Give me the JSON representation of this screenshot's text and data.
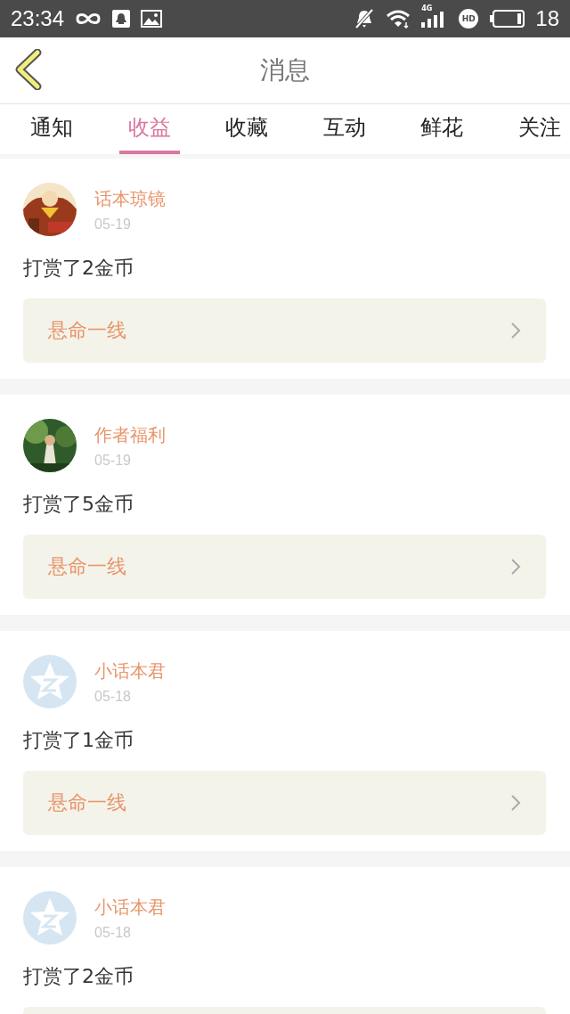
{
  "status_bar": {
    "time": "23:34",
    "network": "4G",
    "hd": "HD",
    "battery": "18"
  },
  "header": {
    "title": "消息"
  },
  "tabs": [
    {
      "label": "通知",
      "selected": false
    },
    {
      "label": "收益",
      "selected": true
    },
    {
      "label": "收藏",
      "selected": false
    },
    {
      "label": "互动",
      "selected": false
    },
    {
      "label": "鲜花",
      "selected": false
    },
    {
      "label": "关注",
      "selected": false
    }
  ],
  "messages": [
    {
      "name": "话本琼镜",
      "date": "05-19",
      "text": "打赏了2金币",
      "book": "悬命一线"
    },
    {
      "name": "作者福利",
      "date": "05-19",
      "text": "打赏了5金币",
      "book": "悬命一线"
    },
    {
      "avatar": {
        "kind": "default"
      },
      "name": "小话本君",
      "date": "05-18",
      "text": "打赏了1金币",
      "book": "悬命一线"
    },
    {
      "avatar": {
        "kind": "default"
      },
      "name": "小话本君",
      "date": "05-18",
      "text": "打赏了2金币"
    }
  ]
}
